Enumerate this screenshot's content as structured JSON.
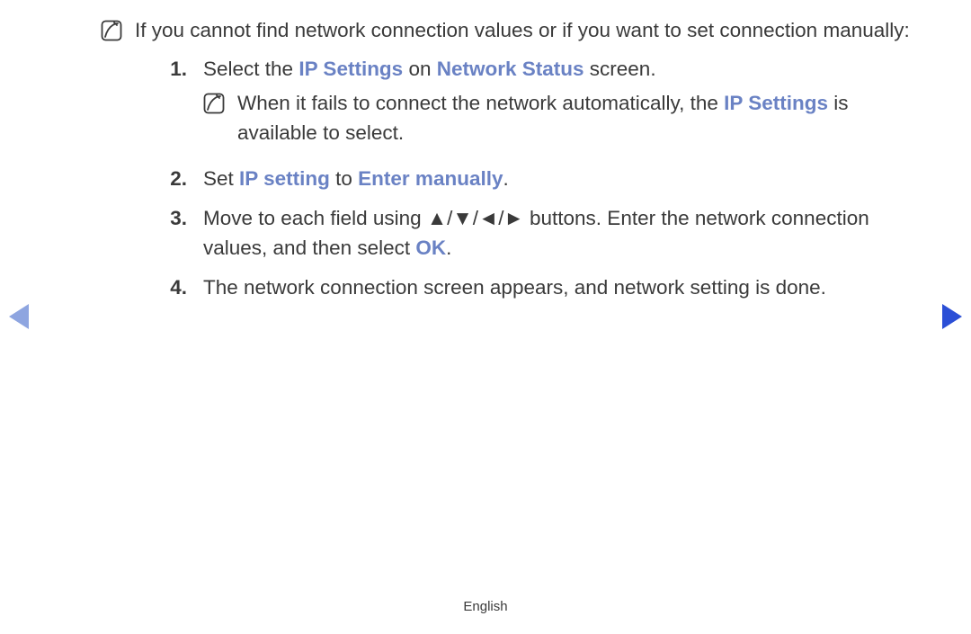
{
  "intro": "If you cannot find network connection values or if you want to set connection manually:",
  "steps": [
    {
      "num": "1.",
      "pre": "Select the ",
      "hl1": "IP Settings",
      "mid": " on ",
      "hl2": "Network Status",
      "post": " screen.",
      "subnote": {
        "pre": "When it fails to connect the network automatically, the ",
        "hl": "IP Settings",
        "post": " is available to select."
      }
    },
    {
      "num": "2.",
      "pre": "Set ",
      "hl1": "IP setting",
      "mid": " to ",
      "hl2": "Enter manually",
      "post": "."
    },
    {
      "num": "3.",
      "pre": "Move to each field using ",
      "glyphs": "▲/▼/◄/►",
      "mid": " buttons. Enter the network connection values, and then select ",
      "hl1": "OK",
      "post": "."
    },
    {
      "num": "4.",
      "text": "The network connection screen appears, and network setting is done."
    }
  ],
  "footer": "English"
}
